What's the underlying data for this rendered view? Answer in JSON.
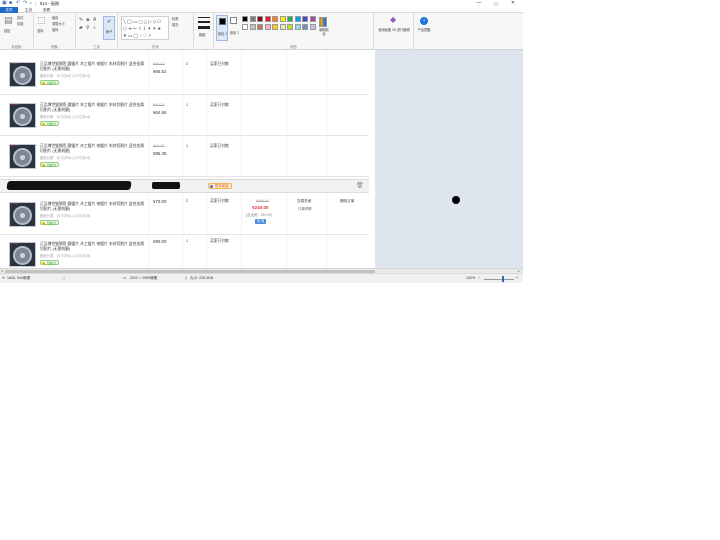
{
  "window": {
    "title": "514 - 画图",
    "controls": [
      "—",
      "☐",
      "✕"
    ]
  },
  "tabs": [
    "文件",
    "主页",
    "查看"
  ],
  "ribbon": {
    "groups": {
      "clipboard": "剪贴板",
      "image": "图像",
      "tools": "工具",
      "shapes": "形状",
      "colors": "颜色"
    },
    "paste": "粘贴",
    "cut": "剪切",
    "copy": "复制",
    "select": "选择",
    "crop": "裁剪",
    "resize": "调整大小",
    "rotate": "旋转",
    "brush": "刷子",
    "outline": "轮廓",
    "fill": "填充",
    "size": "粗细",
    "color1": "颜色 1",
    "color2": "颜色 2",
    "edit_colors": "编辑颜色",
    "paint3d": "使用画图 3D 进行编辑",
    "product_alert": "产品提醒",
    "palette": [
      "#000000",
      "#7f7f7f",
      "#880015",
      "#ed1c24",
      "#ff7f27",
      "#fff200",
      "#22b14c",
      "#00a2e8",
      "#3f48cc",
      "#a349a4",
      "#ffffff",
      "#c3c3c3",
      "#b97a57",
      "#ffaec9",
      "#ffc90e",
      "#efe4b0",
      "#b5e61d",
      "#99d9ea",
      "#7092be",
      "#c8bfe7"
    ]
  },
  "orders": {
    "rows": [
      {
        "name": "正品博世锯钢签 圆锯片 木工锯片 电锯片 木材切割片 适合金属切割片 (无需刻磨)",
        "spec": "颜色分类：10寸(254) | 2.0寸(50.8)",
        "badge": "包邮卡",
        "old_price": "¥65.00",
        "price": "¥65.52",
        "qty": "2",
        "status": "买家已付款"
      },
      {
        "name": "正品博世锯钢签 圆锯片 木工锯片 电锯片 木材切割片 适合金属切割片 (无需刻磨)",
        "spec": "颜色分类：10寸(254) | 2.0寸(50.8)",
        "badge": "包邮卡",
        "old_price": "¥80.00",
        "price": "¥64.56",
        "qty": "1",
        "status": "买家已付款"
      },
      {
        "name": "正品博世锯钢签 圆锯片 木工锯片 电锯片 木材切割片 适合金属切割片 (无需刻磨)",
        "spec": "颜色分类：10寸(254) | 2.0寸(50.8)",
        "badge": "包邮卡",
        "old_price": "¥90.00",
        "price": "¥85.35",
        "qty": "1",
        "status": "买家已付款"
      },
      {
        "name": "正品博世锯钢签 圆锯片 木工锯片 电锯片 木材切割片 适合金属切割片 (无需刻磨)",
        "spec": "颜色分类：10寸(254) | 2.0寸(50.8)",
        "badge": "包邮卡",
        "old_price": "",
        "price": "¥70.00",
        "qty": "2",
        "status": "买家已付款"
      },
      {
        "name": "正品博世锯钢签 圆锯片 木工锯片 电锯片 木材切割片 适合金属切割片 (无需刻磨)",
        "spec": "颜色分类：10寸(254) | 2.0寸(50.8)",
        "badge": "包邮卡",
        "old_price": "",
        "price": "¥90.00",
        "qty": "1",
        "status": "买家已付款"
      }
    ],
    "store_contact": "联系卖家",
    "total_old": "¥598.00",
    "total": "¥240.00",
    "fee": "(含运费：¥10.00)",
    "pay_tag": "查 看",
    "status_1": "交易关闭",
    "status_2": "订单详情",
    "action": "删除订单",
    "brand": "BOSCH"
  },
  "statusbar": {
    "cursor": "1845, 544像素",
    "dimensions": "2912 × 1959像素",
    "filesize": "大小: 225.4KB",
    "zoom": "100%"
  }
}
